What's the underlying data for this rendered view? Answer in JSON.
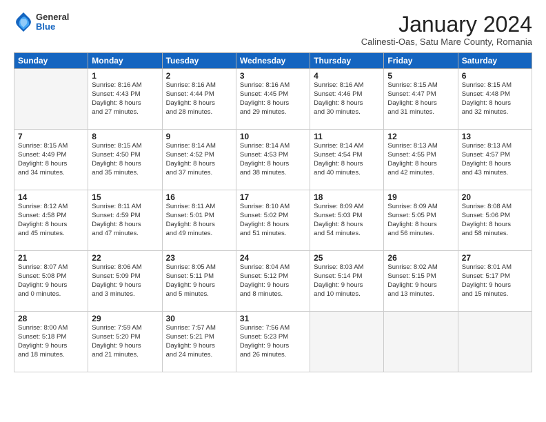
{
  "logo": {
    "general": "General",
    "blue": "Blue"
  },
  "header": {
    "title": "January 2024",
    "subtitle": "Calinesti-Oas, Satu Mare County, Romania"
  },
  "weekdays": [
    "Sunday",
    "Monday",
    "Tuesday",
    "Wednesday",
    "Thursday",
    "Friday",
    "Saturday"
  ],
  "weeks": [
    [
      {
        "day": "",
        "info": ""
      },
      {
        "day": "1",
        "info": "Sunrise: 8:16 AM\nSunset: 4:43 PM\nDaylight: 8 hours\nand 27 minutes."
      },
      {
        "day": "2",
        "info": "Sunrise: 8:16 AM\nSunset: 4:44 PM\nDaylight: 8 hours\nand 28 minutes."
      },
      {
        "day": "3",
        "info": "Sunrise: 8:16 AM\nSunset: 4:45 PM\nDaylight: 8 hours\nand 29 minutes."
      },
      {
        "day": "4",
        "info": "Sunrise: 8:16 AM\nSunset: 4:46 PM\nDaylight: 8 hours\nand 30 minutes."
      },
      {
        "day": "5",
        "info": "Sunrise: 8:15 AM\nSunset: 4:47 PM\nDaylight: 8 hours\nand 31 minutes."
      },
      {
        "day": "6",
        "info": "Sunrise: 8:15 AM\nSunset: 4:48 PM\nDaylight: 8 hours\nand 32 minutes."
      }
    ],
    [
      {
        "day": "7",
        "info": "Sunrise: 8:15 AM\nSunset: 4:49 PM\nDaylight: 8 hours\nand 34 minutes."
      },
      {
        "day": "8",
        "info": "Sunrise: 8:15 AM\nSunset: 4:50 PM\nDaylight: 8 hours\nand 35 minutes."
      },
      {
        "day": "9",
        "info": "Sunrise: 8:14 AM\nSunset: 4:52 PM\nDaylight: 8 hours\nand 37 minutes."
      },
      {
        "day": "10",
        "info": "Sunrise: 8:14 AM\nSunset: 4:53 PM\nDaylight: 8 hours\nand 38 minutes."
      },
      {
        "day": "11",
        "info": "Sunrise: 8:14 AM\nSunset: 4:54 PM\nDaylight: 8 hours\nand 40 minutes."
      },
      {
        "day": "12",
        "info": "Sunrise: 8:13 AM\nSunset: 4:55 PM\nDaylight: 8 hours\nand 42 minutes."
      },
      {
        "day": "13",
        "info": "Sunrise: 8:13 AM\nSunset: 4:57 PM\nDaylight: 8 hours\nand 43 minutes."
      }
    ],
    [
      {
        "day": "14",
        "info": "Sunrise: 8:12 AM\nSunset: 4:58 PM\nDaylight: 8 hours\nand 45 minutes."
      },
      {
        "day": "15",
        "info": "Sunrise: 8:11 AM\nSunset: 4:59 PM\nDaylight: 8 hours\nand 47 minutes."
      },
      {
        "day": "16",
        "info": "Sunrise: 8:11 AM\nSunset: 5:01 PM\nDaylight: 8 hours\nand 49 minutes."
      },
      {
        "day": "17",
        "info": "Sunrise: 8:10 AM\nSunset: 5:02 PM\nDaylight: 8 hours\nand 51 minutes."
      },
      {
        "day": "18",
        "info": "Sunrise: 8:09 AM\nSunset: 5:03 PM\nDaylight: 8 hours\nand 54 minutes."
      },
      {
        "day": "19",
        "info": "Sunrise: 8:09 AM\nSunset: 5:05 PM\nDaylight: 8 hours\nand 56 minutes."
      },
      {
        "day": "20",
        "info": "Sunrise: 8:08 AM\nSunset: 5:06 PM\nDaylight: 8 hours\nand 58 minutes."
      }
    ],
    [
      {
        "day": "21",
        "info": "Sunrise: 8:07 AM\nSunset: 5:08 PM\nDaylight: 9 hours\nand 0 minutes."
      },
      {
        "day": "22",
        "info": "Sunrise: 8:06 AM\nSunset: 5:09 PM\nDaylight: 9 hours\nand 3 minutes."
      },
      {
        "day": "23",
        "info": "Sunrise: 8:05 AM\nSunset: 5:11 PM\nDaylight: 9 hours\nand 5 minutes."
      },
      {
        "day": "24",
        "info": "Sunrise: 8:04 AM\nSunset: 5:12 PM\nDaylight: 9 hours\nand 8 minutes."
      },
      {
        "day": "25",
        "info": "Sunrise: 8:03 AM\nSunset: 5:14 PM\nDaylight: 9 hours\nand 10 minutes."
      },
      {
        "day": "26",
        "info": "Sunrise: 8:02 AM\nSunset: 5:15 PM\nDaylight: 9 hours\nand 13 minutes."
      },
      {
        "day": "27",
        "info": "Sunrise: 8:01 AM\nSunset: 5:17 PM\nDaylight: 9 hours\nand 15 minutes."
      }
    ],
    [
      {
        "day": "28",
        "info": "Sunrise: 8:00 AM\nSunset: 5:18 PM\nDaylight: 9 hours\nand 18 minutes."
      },
      {
        "day": "29",
        "info": "Sunrise: 7:59 AM\nSunset: 5:20 PM\nDaylight: 9 hours\nand 21 minutes."
      },
      {
        "day": "30",
        "info": "Sunrise: 7:57 AM\nSunset: 5:21 PM\nDaylight: 9 hours\nand 24 minutes."
      },
      {
        "day": "31",
        "info": "Sunrise: 7:56 AM\nSunset: 5:23 PM\nDaylight: 9 hours\nand 26 minutes."
      },
      {
        "day": "",
        "info": ""
      },
      {
        "day": "",
        "info": ""
      },
      {
        "day": "",
        "info": ""
      }
    ]
  ]
}
